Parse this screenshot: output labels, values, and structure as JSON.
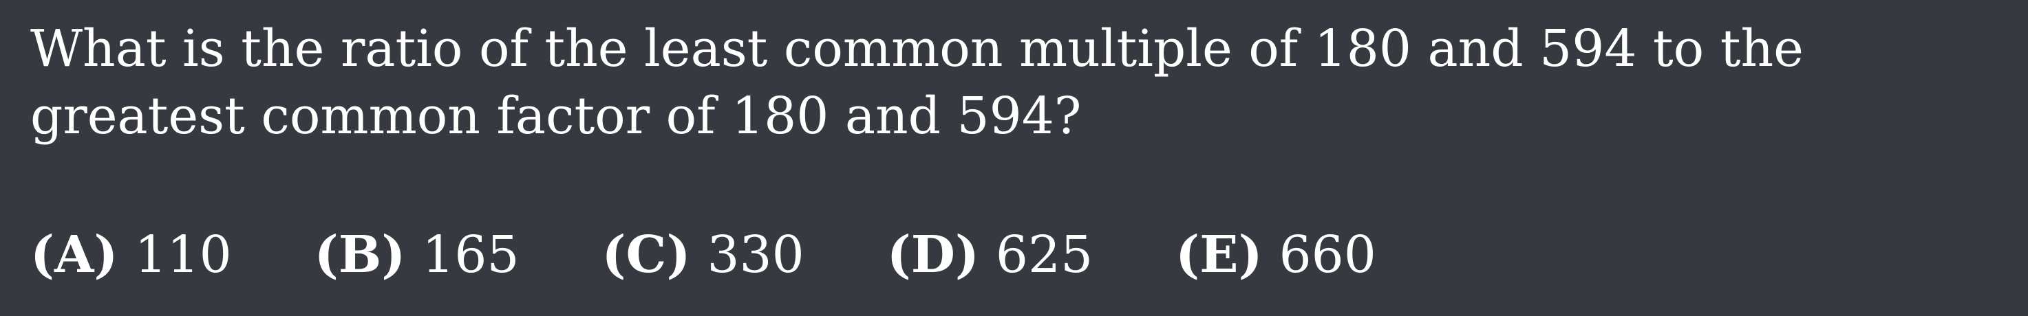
{
  "question": {
    "text": "What is the ratio of the least common multiple of 180 and 594 to the greatest common factor of 180 and 594?"
  },
  "choices": [
    {
      "letter": "(A)",
      "value": "110"
    },
    {
      "letter": "(B)",
      "value": "165"
    },
    {
      "letter": "(C)",
      "value": "330"
    },
    {
      "letter": "(D)",
      "value": "625"
    },
    {
      "letter": "(E)",
      "value": "660"
    }
  ]
}
